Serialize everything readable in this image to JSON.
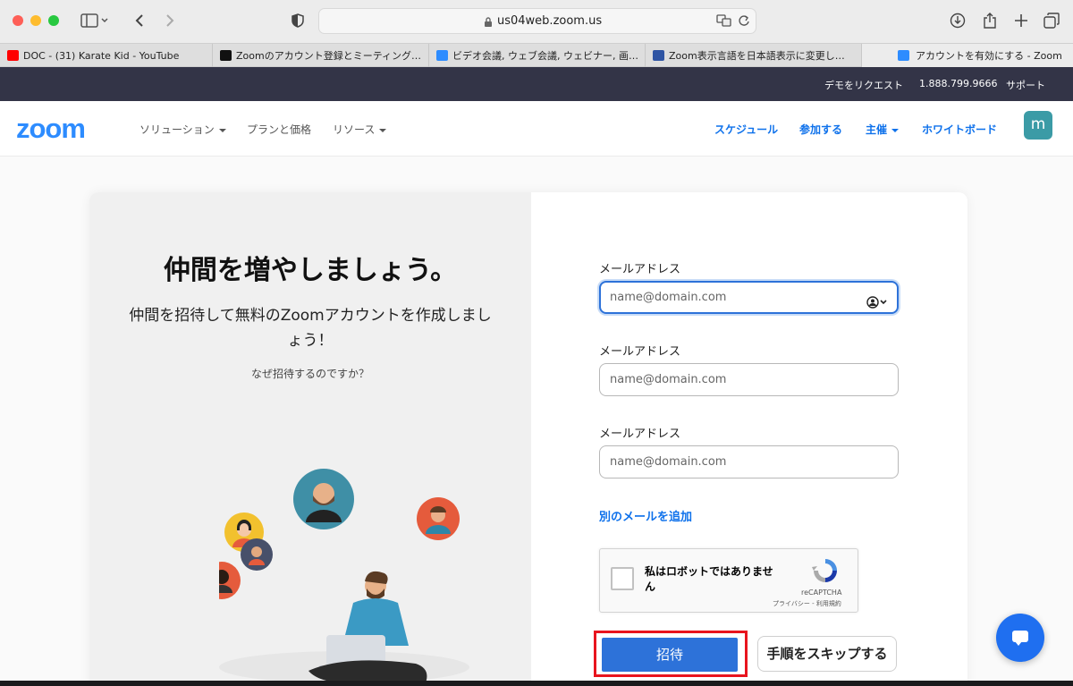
{
  "browser": {
    "url": "us04web.zoom.us",
    "tabs": [
      {
        "title": "DOC - (31) Karate Kid - YouTube",
        "favicon_color": "#ff0000"
      },
      {
        "title": "Zoomのアカウント登録とミーティング…",
        "favicon_color": "#111111"
      },
      {
        "title": "ビデオ会議, ウェブ会議, ウェビナー, 画…",
        "favicon_color": "#2d8cff"
      },
      {
        "title": "Zoom表示言語を日本語表示に変更し…",
        "favicon_color": "#2f55a4"
      },
      {
        "title": "アカウントを有効にする - Zoom",
        "favicon_color": "#2d8cff"
      }
    ]
  },
  "topbar": {
    "demo": "デモをリクエスト",
    "phone": "1.888.799.9666",
    "support": "サポート"
  },
  "nav": {
    "logo": "zoom",
    "solutions": "ソリューション",
    "plans": "プランと価格",
    "resources": "リソース",
    "schedule": "スケジュール",
    "join": "参加する",
    "host": "主催",
    "whiteboard": "ホワイトボード",
    "avatar_letter": "m"
  },
  "invite": {
    "heading": "仲間を増やしましょう。",
    "subtext": "仲間を招待して無料のZoomアカウントを作成しましょう！",
    "why": "なぜ招待するのですか？",
    "fields": [
      {
        "label": "メールアドレス",
        "placeholder": "name@domain.com"
      },
      {
        "label": "メールアドレス",
        "placeholder": "name@domain.com"
      },
      {
        "label": "メールアドレス",
        "placeholder": "name@domain.com"
      }
    ],
    "add_email": "別のメールを追加",
    "recaptcha": {
      "text": "私はロボットではありません",
      "brand": "reCAPTCHA",
      "terms": "プライバシー - 利用規約"
    },
    "invite_button": "招待",
    "skip_button": "手順をスキップする"
  },
  "colors": {
    "zoom_blue": "#2d8cff",
    "link_blue": "#0e71eb",
    "button_blue": "#2d72d9",
    "highlight_red": "#e8141e",
    "topbar_bg": "#333447"
  }
}
